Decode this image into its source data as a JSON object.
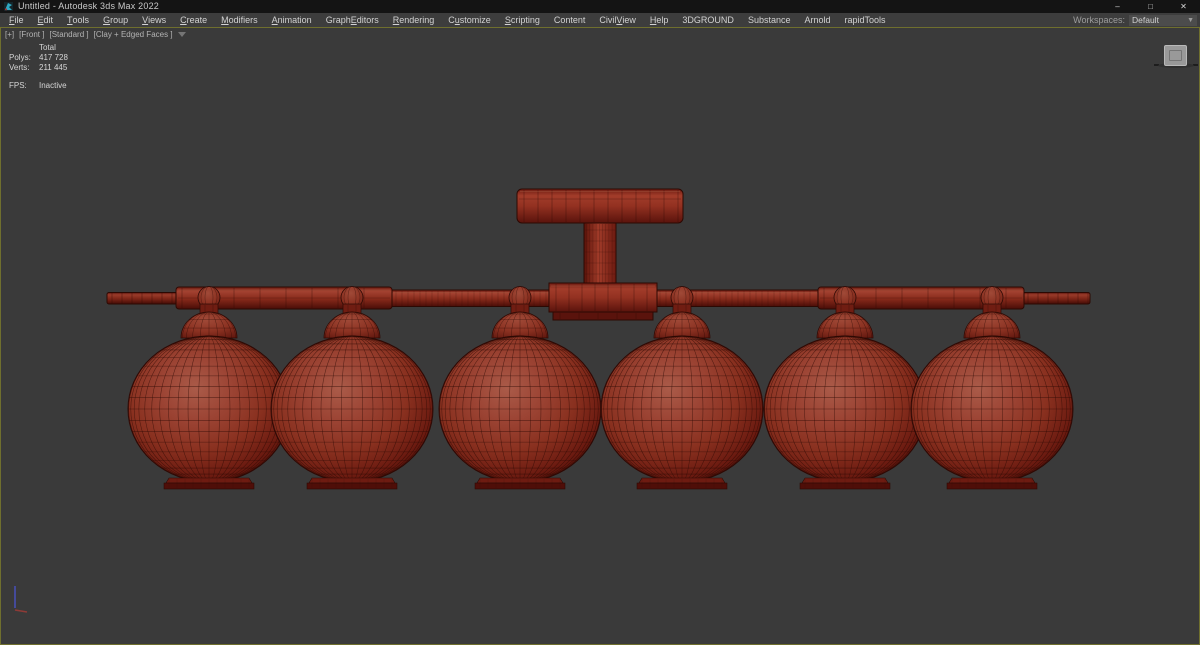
{
  "window": {
    "title": "Untitled - Autodesk 3ds Max 2022",
    "app_icon": "3ds-max-logo",
    "controls": {
      "minimize": "–",
      "maximize": "□",
      "close": "✕"
    }
  },
  "menubar": {
    "items": [
      {
        "label": "File",
        "accel_index": 0
      },
      {
        "label": "Edit",
        "accel_index": 0
      },
      {
        "label": "Tools",
        "accel_index": 0
      },
      {
        "label": "Group",
        "accel_index": 0
      },
      {
        "label": "Views",
        "accel_index": 0
      },
      {
        "label": "Create",
        "accel_index": 0
      },
      {
        "label": "Modifiers",
        "accel_index": 0
      },
      {
        "label": "Animation",
        "accel_index": 0
      },
      {
        "label": "Graph Editors",
        "accel_index": 6
      },
      {
        "label": "Rendering",
        "accel_index": 0
      },
      {
        "label": "Customize",
        "accel_index": 1
      },
      {
        "label": "Scripting",
        "accel_index": 0
      },
      {
        "label": "Content",
        "accel_index": -1
      },
      {
        "label": "Civil View",
        "accel_index": 6
      },
      {
        "label": "Help",
        "accel_index": 0
      },
      {
        "label": "3DGROUND",
        "accel_index": -1
      },
      {
        "label": "Substance",
        "accel_index": -1
      },
      {
        "label": "Arnold",
        "accel_index": -1
      },
      {
        "label": "rapidTools",
        "accel_index": -1
      }
    ],
    "workspaces_label": "Workspaces:",
    "workspaces_value": "Default"
  },
  "viewport": {
    "label_tokens": [
      "[+]",
      "[Front ]",
      "[Standard ]",
      "[Clay + Edged Faces ]"
    ],
    "stats": {
      "total_label": "Total",
      "polys_label": "Polys:",
      "polys_value": "417 728",
      "verts_label": "Verts:",
      "verts_value": "211 445",
      "fps_label": "FPS:",
      "fps_value": "Inactive"
    },
    "viewcube_face": "front"
  },
  "colors": {
    "titlebar_bg": "#141414",
    "menubar_bg": "#3d3d3d",
    "viewport_bg": "#3a3a3a",
    "viewport_border": "#6f6f2e",
    "model_wire": "#2e0a05",
    "model_red_highlight": "#aa5b49",
    "model_red_mid": "#8c3021",
    "model_red_dark": "#4f0e08",
    "axis_x_red": "#b23a35",
    "axis_y_blue": "#4a55d0"
  }
}
